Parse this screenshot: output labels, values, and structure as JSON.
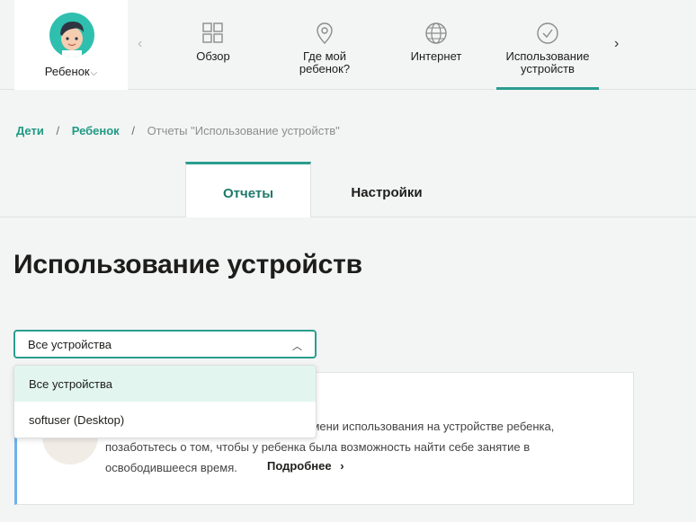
{
  "child": {
    "name": "Ребенок"
  },
  "nav": {
    "items": [
      {
        "label_lines": [
          "Обзор"
        ]
      },
      {
        "label_lines": [
          "Где мой",
          "ребенок?"
        ]
      },
      {
        "label_lines": [
          "Интернет"
        ]
      },
      {
        "label_lines": [
          "Использование",
          "устройств"
        ]
      }
    ]
  },
  "breadcrumb": {
    "items": [
      "Дети",
      "Ребенок"
    ],
    "current": "Отчеты \"Использование устройств\""
  },
  "tabs": {
    "reports": "Отчеты",
    "settings": "Настройки"
  },
  "page": {
    "title": "Использование устройств"
  },
  "device_select": {
    "value": "Все устройства",
    "options": [
      "Все устройства",
      "softuser (Desktop)"
    ]
  },
  "info": {
    "line1": "ремени использования на устройстве ребенка,",
    "line2": "позаботьтесь о том, чтобы у ребенка была возможность найти себе занятие в",
    "line3": "освободившееся время.",
    "more": "Подробнее"
  },
  "colors": {
    "accent": "#2a9d8f",
    "link": "#1f9a84",
    "info_border": "#6fb1e8",
    "option_selected": "#e2f6ef"
  }
}
